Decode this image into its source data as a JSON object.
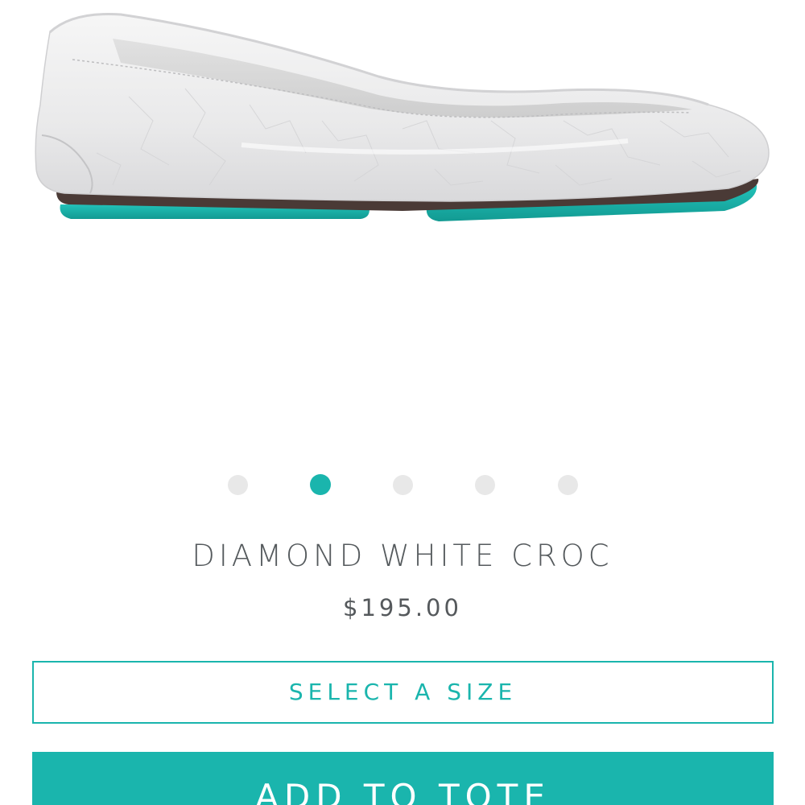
{
  "product": {
    "name": "DIAMOND WHITE CROC",
    "price": "$195.00",
    "image_alt": "Diamond White Croc ballet flat",
    "sole_color": "#1ab5ad",
    "upper_color": "#ececec"
  },
  "carousel": {
    "slide_count": 5,
    "active_index": 1
  },
  "actions": {
    "select_size_label": "SELECT A SIZE",
    "add_to_tote_label": "ADD TO TOTE"
  },
  "theme": {
    "accent": "#1ab5ad",
    "text": "#555a5d",
    "dot_inactive": "#e8e8e8"
  }
}
